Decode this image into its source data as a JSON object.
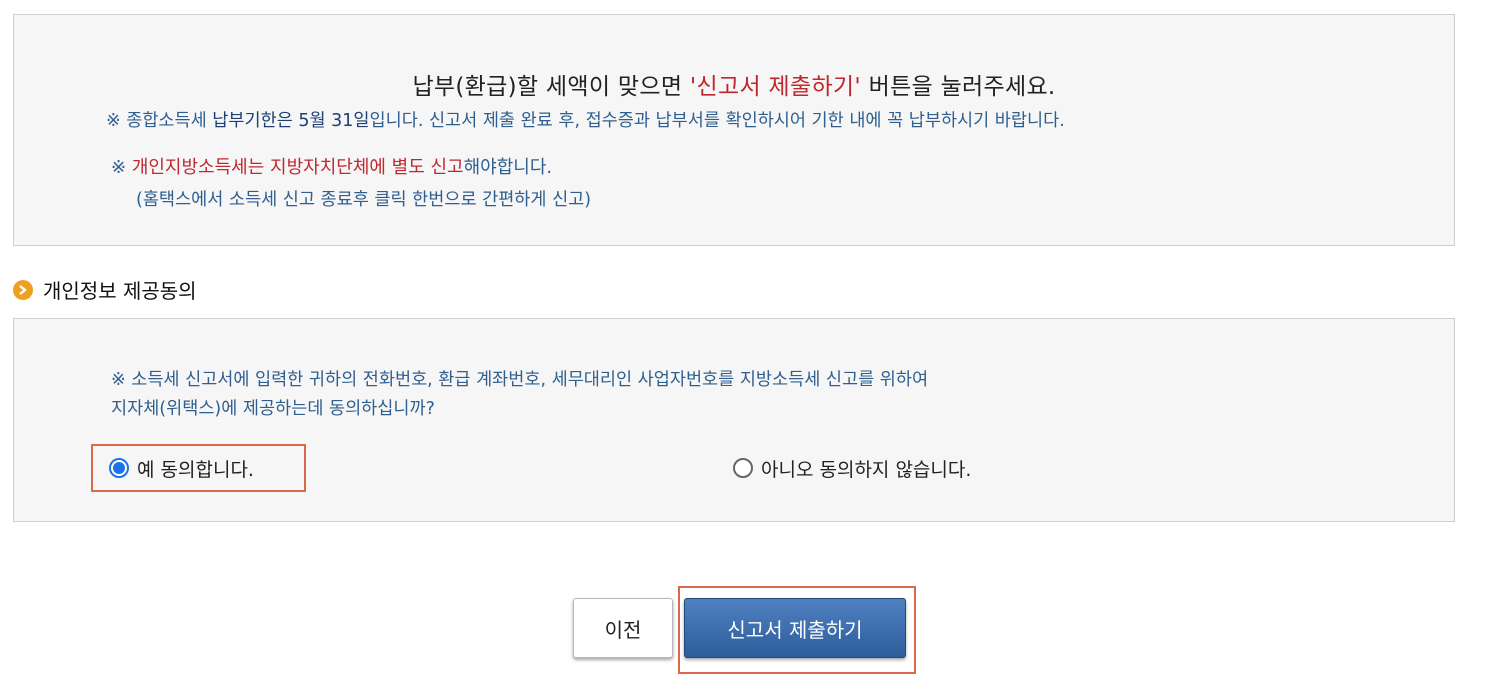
{
  "notice": {
    "headline_part1": "납부(환급)할 세액이 맞으면 ",
    "headline_highlight": "'신고서 제출하기'",
    "headline_part2": " 버튼을 눌러주세요.",
    "line1_prefix": "※ 종합소득세 ",
    "line1_bold": "납부기한은 5월 31일",
    "line1_rest": "입니다. 신고서 제출 완료 후, 접수증과 납부서를 확인하시어 기한 내에 꼭 납부하시기 바랍니다.",
    "line2_prefix": "※ ",
    "line2_highlight": "개인지방소득세는 지방자치단체에 별도 신고",
    "line2_rest": "해야합니다.",
    "line3": "(홈택스에서 소득세 신고 종료후 클릭 한번으로 간편하게 신고)"
  },
  "consent": {
    "section_title": "개인정보 제공동의",
    "question_line1": "※ 소득세 신고서에 입력한 귀하의 전화번호, 환급 계좌번호, 세무대리인 사업자번호를 지방소득세 신고를 위하여",
    "question_line2": "지자체(위택스)에 제공하는데 동의하십니까?",
    "option_yes": "예 동의합니다.",
    "option_no": "아니오 동의하지 않습니다.",
    "selected": "yes"
  },
  "buttons": {
    "prev": "이전",
    "submit": "신고서 제출하기"
  },
  "colors": {
    "accent_red": "#c0282f",
    "text_blue": "#2f5f8f",
    "submit_blue": "#2e5d9c",
    "highlight_border": "#d9694a"
  }
}
